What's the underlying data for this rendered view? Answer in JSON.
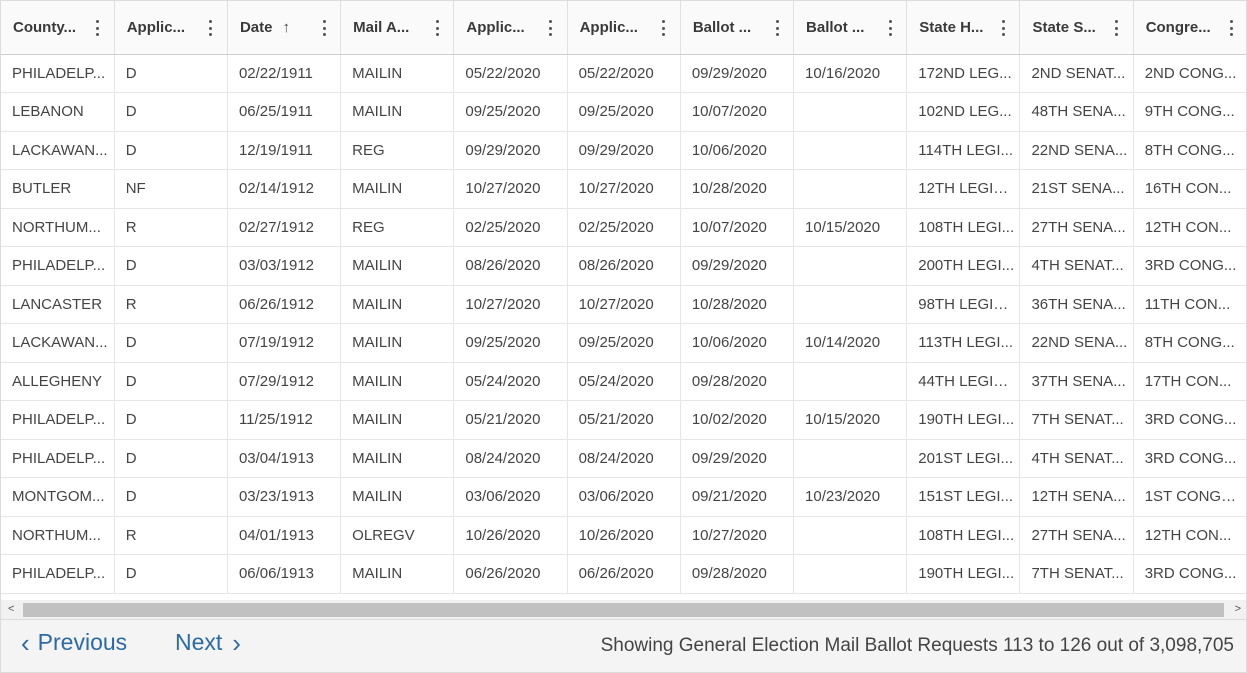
{
  "columns": [
    {
      "label": "County...",
      "sort": ""
    },
    {
      "label": "Applic...",
      "sort": ""
    },
    {
      "label": "Date",
      "sort": "↑"
    },
    {
      "label": "Mail A...",
      "sort": ""
    },
    {
      "label": "Applic...",
      "sort": ""
    },
    {
      "label": "Applic...",
      "sort": ""
    },
    {
      "label": "Ballot ...",
      "sort": ""
    },
    {
      "label": "Ballot ...",
      "sort": ""
    },
    {
      "label": "State H...",
      "sort": ""
    },
    {
      "label": "State S...",
      "sort": ""
    },
    {
      "label": "Congre...",
      "sort": ""
    }
  ],
  "rows": [
    [
      "PHILADELP...",
      "D",
      "02/22/1911",
      "MAILIN",
      "05/22/2020",
      "05/22/2020",
      "09/29/2020",
      "10/16/2020",
      "172ND LEG...",
      "2ND SENAT...",
      "2ND CONG..."
    ],
    [
      "LEBANON",
      "D",
      "06/25/1911",
      "MAILIN",
      "09/25/2020",
      "09/25/2020",
      "10/07/2020",
      "",
      "102ND LEG...",
      "48TH SENA...",
      "9TH CONG..."
    ],
    [
      "LACKAWAN...",
      "D",
      "12/19/1911",
      "REG",
      "09/29/2020",
      "09/29/2020",
      "10/06/2020",
      "",
      "114TH LEGI...",
      "22ND SENA...",
      "8TH CONG..."
    ],
    [
      "BUTLER",
      "NF",
      "02/14/1912",
      "MAILIN",
      "10/27/2020",
      "10/27/2020",
      "10/28/2020",
      "",
      "12TH LEGIS...",
      "21ST SENA...",
      "16TH CON..."
    ],
    [
      "NORTHUM...",
      "R",
      "02/27/1912",
      "REG",
      "02/25/2020",
      "02/25/2020",
      "10/07/2020",
      "10/15/2020",
      "108TH LEGI...",
      "27TH SENA...",
      "12TH CON..."
    ],
    [
      "PHILADELP...",
      "D",
      "03/03/1912",
      "MAILIN",
      "08/26/2020",
      "08/26/2020",
      "09/29/2020",
      "",
      "200TH LEGI...",
      "4TH SENAT...",
      "3RD CONG..."
    ],
    [
      "LANCASTER",
      "R",
      "06/26/1912",
      "MAILIN",
      "10/27/2020",
      "10/27/2020",
      "10/28/2020",
      "",
      "98TH LEGIS...",
      "36TH SENA...",
      "11TH CON..."
    ],
    [
      "LACKAWAN...",
      "D",
      "07/19/1912",
      "MAILIN",
      "09/25/2020",
      "09/25/2020",
      "10/06/2020",
      "10/14/2020",
      "113TH LEGI...",
      "22ND SENA...",
      "8TH CONG..."
    ],
    [
      "ALLEGHENY",
      "D",
      "07/29/1912",
      "MAILIN",
      "05/24/2020",
      "05/24/2020",
      "09/28/2020",
      "",
      "44TH LEGIS...",
      "37TH SENA...",
      "17TH CON..."
    ],
    [
      "PHILADELP...",
      "D",
      "11/25/1912",
      "MAILIN",
      "05/21/2020",
      "05/21/2020",
      "10/02/2020",
      "10/15/2020",
      "190TH LEGI...",
      "7TH SENAT...",
      "3RD CONG..."
    ],
    [
      "PHILADELP...",
      "D",
      "03/04/1913",
      "MAILIN",
      "08/24/2020",
      "08/24/2020",
      "09/29/2020",
      "",
      "201ST LEGI...",
      "4TH SENAT...",
      "3RD CONG..."
    ],
    [
      "MONTGOM...",
      "D",
      "03/23/1913",
      "MAILIN",
      "03/06/2020",
      "03/06/2020",
      "09/21/2020",
      "10/23/2020",
      "151ST LEGI...",
      "12TH SENA...",
      "1ST CONGR..."
    ],
    [
      "NORTHUM...",
      "R",
      "04/01/1913",
      "OLREGV",
      "10/26/2020",
      "10/26/2020",
      "10/27/2020",
      "",
      "108TH LEGI...",
      "27TH SENA...",
      "12TH CON..."
    ],
    [
      "PHILADELP...",
      "D",
      "06/06/1913",
      "MAILIN",
      "06/26/2020",
      "06/26/2020",
      "09/28/2020",
      "",
      "190TH LEGI...",
      "7TH SENAT...",
      "3RD CONG..."
    ]
  ],
  "scrollbar": {
    "left_arrow": "<",
    "right_arrow": ">"
  },
  "pager": {
    "prev_chevron": "‹",
    "prev_label": "Previous",
    "next_label": "Next",
    "next_chevron": "›"
  },
  "status_text": "Showing General Election Mail Ballot Requests 113 to 126 out of 3,098,705",
  "colors": {
    "link": "#2b6aa6",
    "header_bg": "#fafafa",
    "footer_bg": "#f4f4f4",
    "scroll_thumb": "#c1c1c1"
  }
}
